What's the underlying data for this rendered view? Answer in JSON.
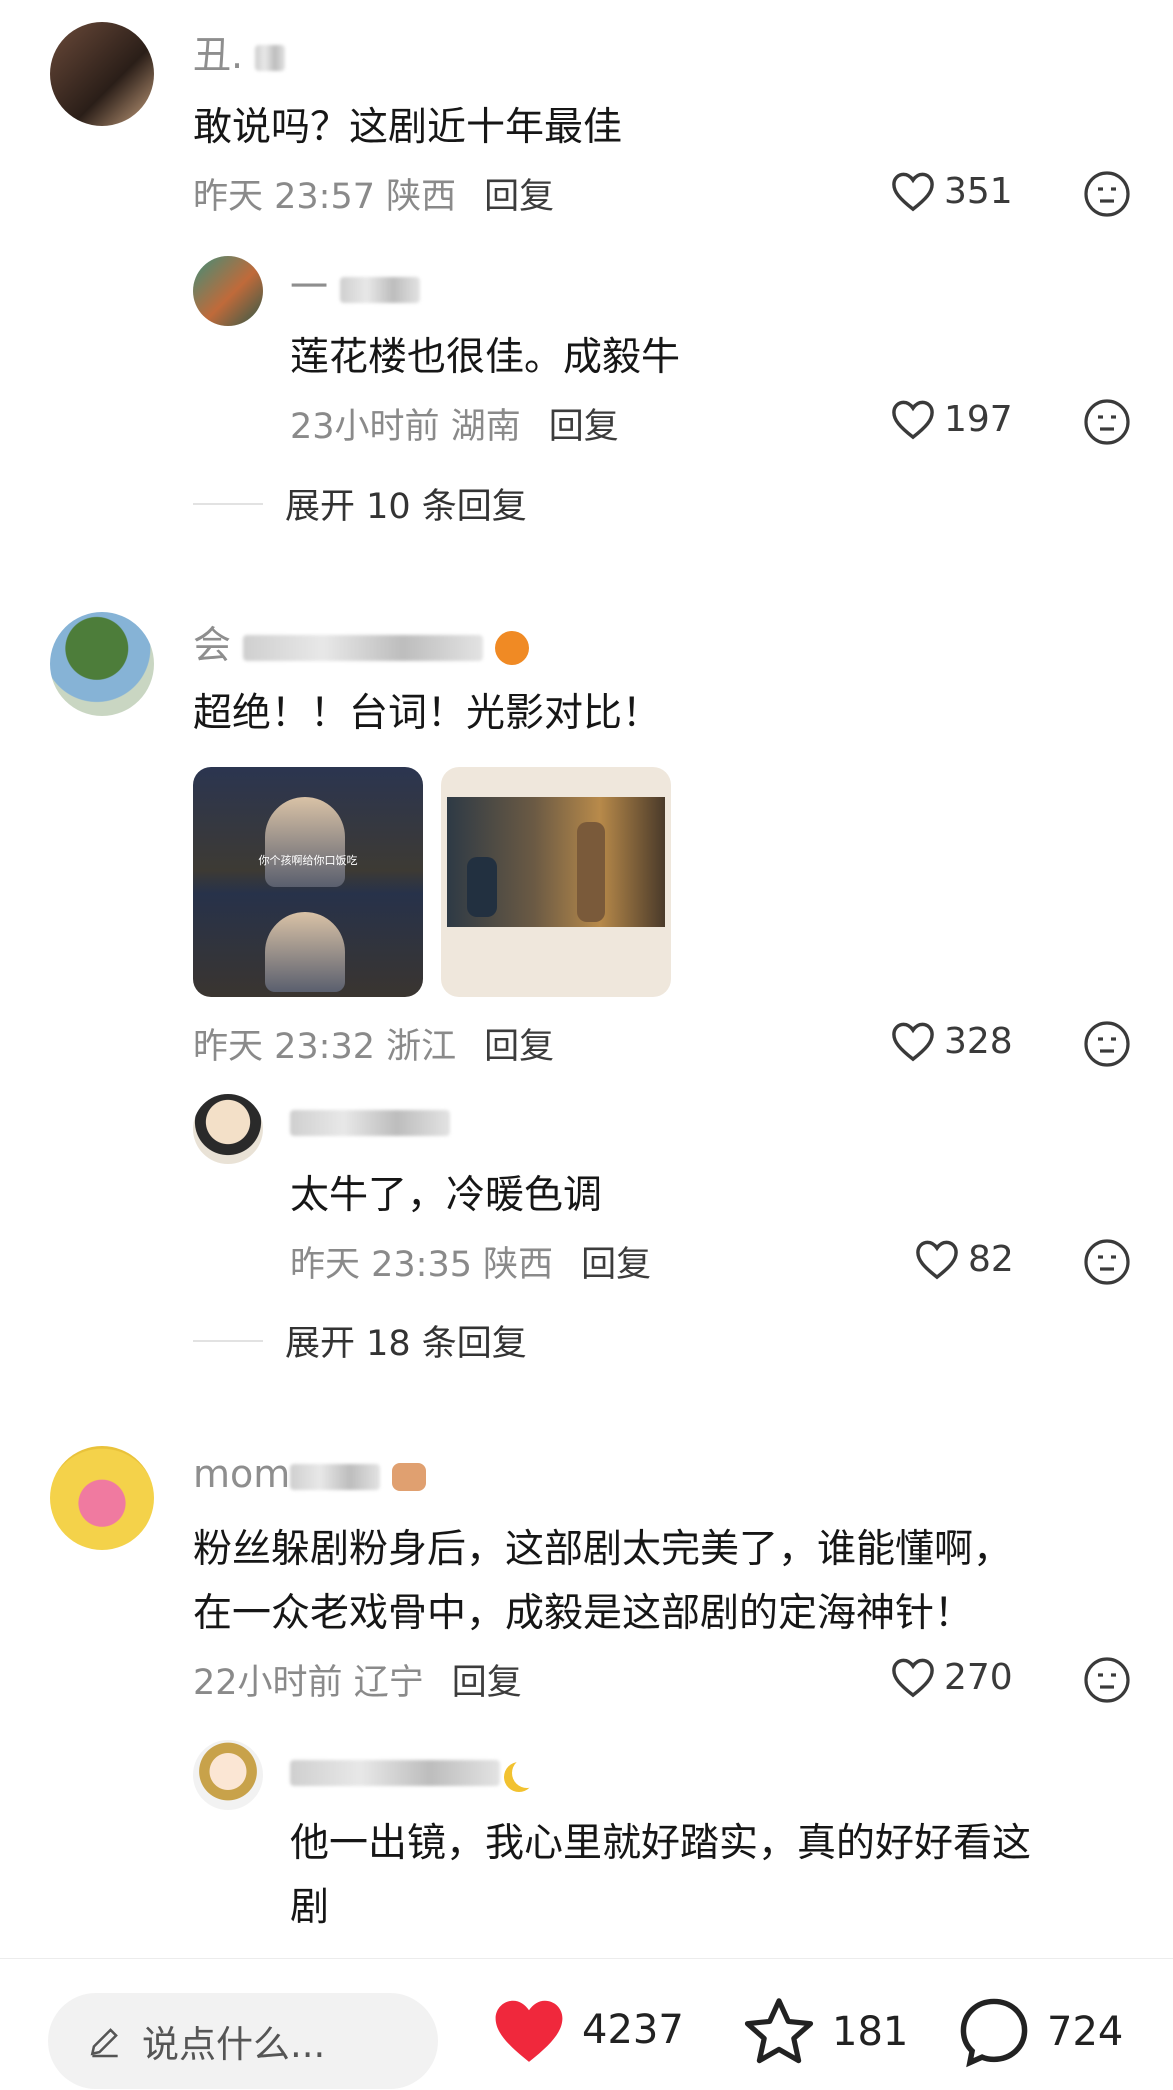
{
  "comments": [
    {
      "name": "丑.",
      "text": "敢说吗？这剧近十年最佳",
      "time": "昨天 23:57",
      "location": "陕西",
      "reply_label": "回复",
      "likes": "351",
      "replies": [
        {
          "name": "一",
          "text": "莲花楼也很佳。成毅牛",
          "time": "23小时前",
          "location": "湖南",
          "reply_label": "回复",
          "likes": "197"
        }
      ],
      "expand_label": "展开 10 条回复"
    },
    {
      "name": "会",
      "text": "超绝！！台词！光影对比！",
      "time": "昨天 23:32",
      "location": "浙江",
      "reply_label": "回复",
      "likes": "328",
      "images": [
        {
          "caption": "你个孩啊给你口饭吃"
        }
      ],
      "replies": [
        {
          "name": "",
          "text": "太牛了，冷暖色调",
          "time": "昨天 23:35",
          "location": "陕西",
          "reply_label": "回复",
          "likes": "82"
        }
      ],
      "expand_label": "展开 18 条回复"
    },
    {
      "name": "mom",
      "text_lines": [
        "粉丝躲剧粉身后，这部剧太完美了，谁能懂啊，",
        "在一众老戏骨中，成毅是这部剧的定海神针！"
      ],
      "time": "22小时前",
      "location": "辽宁",
      "reply_label": "回复",
      "likes": "270",
      "replies": [
        {
          "name": "",
          "text_lines": [
            "他一出镜，我心里就好踏实，真的好好看这",
            "剧"
          ]
        }
      ]
    }
  ],
  "bottom_bar": {
    "input_placeholder": "说点什么...",
    "likes": "4237",
    "favorites": "181",
    "comments": "724"
  },
  "colors": {
    "like_red": "#f0283c",
    "meta_gray": "#8a8a8a",
    "name_gray": "#8e8e8e"
  }
}
